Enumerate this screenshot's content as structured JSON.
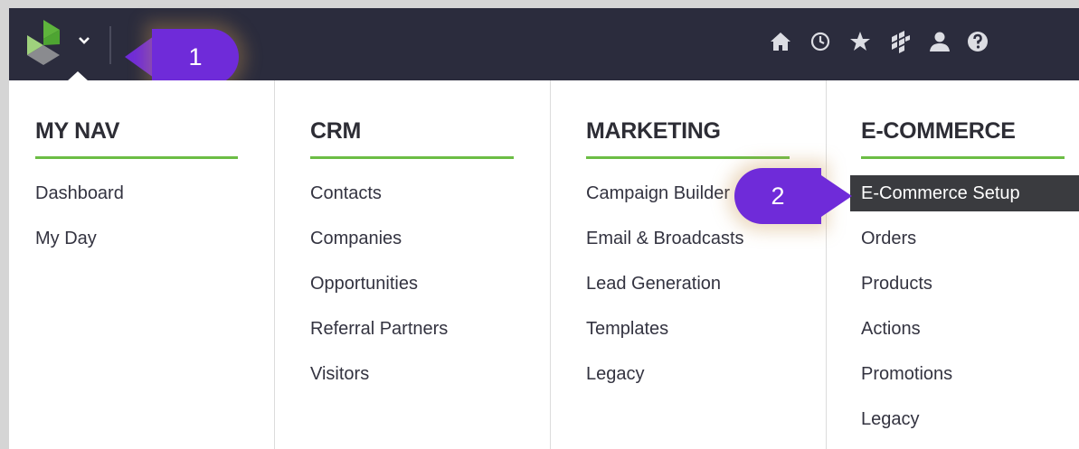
{
  "callouts": {
    "one": "1",
    "two": "2"
  },
  "topbar": {
    "icons": [
      "home-icon",
      "clock-icon",
      "star-icon",
      "dashboard-grid-icon",
      "user-icon",
      "help-icon"
    ]
  },
  "columns": [
    {
      "title": "MY NAV",
      "items": [
        "Dashboard",
        "My Day"
      ]
    },
    {
      "title": "CRM",
      "items": [
        "Contacts",
        "Companies",
        "Opportunities",
        "Referral Partners",
        "Visitors"
      ]
    },
    {
      "title": "MARKETING",
      "items": [
        "Campaign Builder",
        "Email & Broadcasts",
        "Lead Generation",
        "Templates",
        "Legacy"
      ]
    },
    {
      "title": "E-COMMERCE",
      "items": [
        "E-Commerce Setup",
        "Orders",
        "Products",
        "Actions",
        "Promotions",
        "Legacy"
      ]
    }
  ],
  "colors": {
    "topbar": "#2b2c3d",
    "accent_rule": "#6cbd45",
    "callout": "#6f2bd9",
    "active_item": "#3a3b3f"
  }
}
